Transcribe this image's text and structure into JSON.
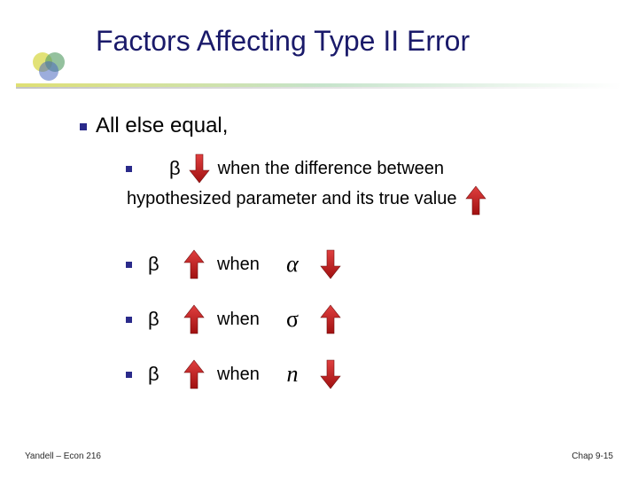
{
  "title": "Factors Affecting Type II Error",
  "main_bullet": "All else equal,",
  "sub1": {
    "beta": "β",
    "text1": "when the difference between",
    "text2": "hypothesized parameter and its true value"
  },
  "rows": [
    {
      "beta": "β",
      "when": "when",
      "sym": "α"
    },
    {
      "beta": "β",
      "when": "when",
      "sym": "σ"
    },
    {
      "beta": "β",
      "when": "when",
      "sym": "n"
    }
  ],
  "footer_left": "Yandell – Econ 216",
  "footer_right": "Chap 9-15"
}
